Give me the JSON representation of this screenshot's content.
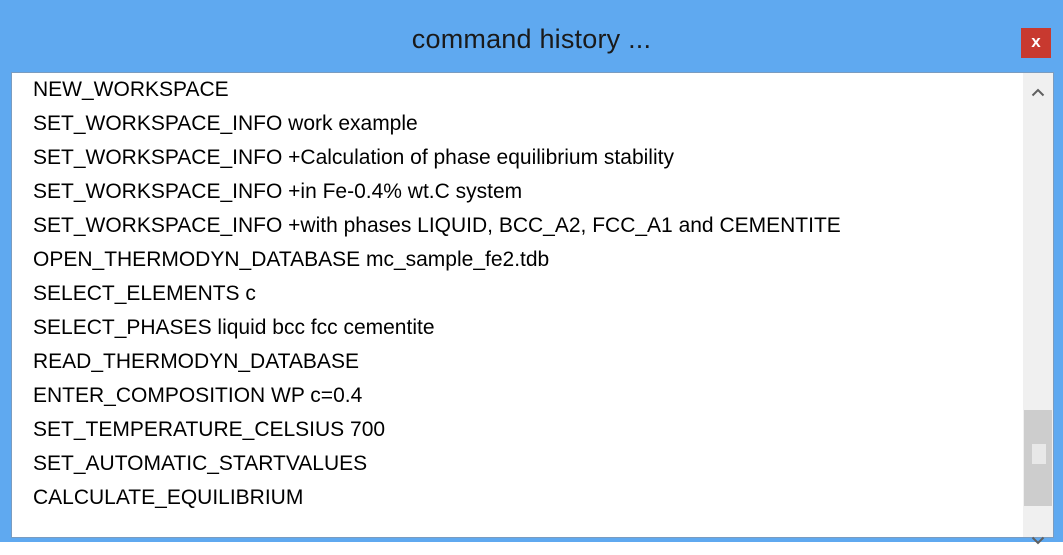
{
  "window": {
    "title": "command history ...",
    "close_label": "x"
  },
  "history": {
    "items": [
      "NEW_WORKSPACE",
      "SET_WORKSPACE_INFO work example",
      "SET_WORKSPACE_INFO +Calculation of phase equilibrium stability",
      "SET_WORKSPACE_INFO +in Fe-0.4% wt.C system",
      "SET_WORKSPACE_INFO +with phases LIQUID, BCC_A2, FCC_A1 and CEMENTITE",
      "OPEN_THERMODYN_DATABASE mc_sample_fe2.tdb",
      "SELECT_ELEMENTS c",
      "SELECT_PHASES liquid bcc fcc cementite",
      "READ_THERMODYN_DATABASE",
      "ENTER_COMPOSITION WP c=0.4",
      "SET_TEMPERATURE_CELSIUS 700",
      "SET_AUTOMATIC_STARTVALUES",
      "CALCULATE_EQUILIBRIUM"
    ]
  },
  "scrollbar": {
    "up_icon": "chevron-up-icon",
    "down_icon": "chevron-down-icon"
  },
  "colors": {
    "titlebar": "#5fa9f0",
    "close_button": "#c8392f"
  }
}
